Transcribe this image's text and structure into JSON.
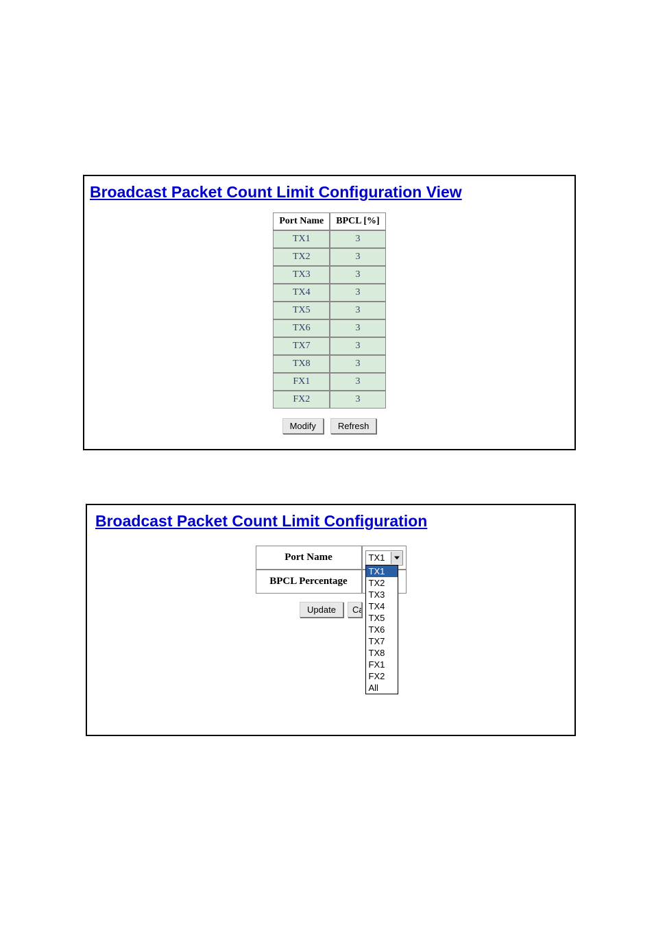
{
  "view_panel": {
    "title": "Broadcast Packet Count Limit Configuration View",
    "headers": {
      "port": "Port Name",
      "bpcl": "BPCL [%]"
    },
    "rows": [
      {
        "port": "TX1",
        "bpcl": "3"
      },
      {
        "port": "TX2",
        "bpcl": "3"
      },
      {
        "port": "TX3",
        "bpcl": "3"
      },
      {
        "port": "TX4",
        "bpcl": "3"
      },
      {
        "port": "TX5",
        "bpcl": "3"
      },
      {
        "port": "TX6",
        "bpcl": "3"
      },
      {
        "port": "TX7",
        "bpcl": "3"
      },
      {
        "port": "TX8",
        "bpcl": "3"
      },
      {
        "port": "FX1",
        "bpcl": "3"
      },
      {
        "port": "FX2",
        "bpcl": "3"
      }
    ],
    "buttons": {
      "modify": "Modify",
      "refresh": "Refresh"
    }
  },
  "config_panel": {
    "title": "Broadcast Packet Count Limit Configuration",
    "fields": {
      "port_name_label": "Port Name",
      "bpcl_pct_label": "BPCL Percentage"
    },
    "port_select": {
      "selected": "TX1",
      "options": [
        "TX1",
        "TX2",
        "TX3",
        "TX4",
        "TX5",
        "TX6",
        "TX7",
        "TX8",
        "FX1",
        "FX2",
        "All"
      ]
    },
    "buttons": {
      "update": "Update",
      "cancel_partial": "Ca"
    }
  }
}
